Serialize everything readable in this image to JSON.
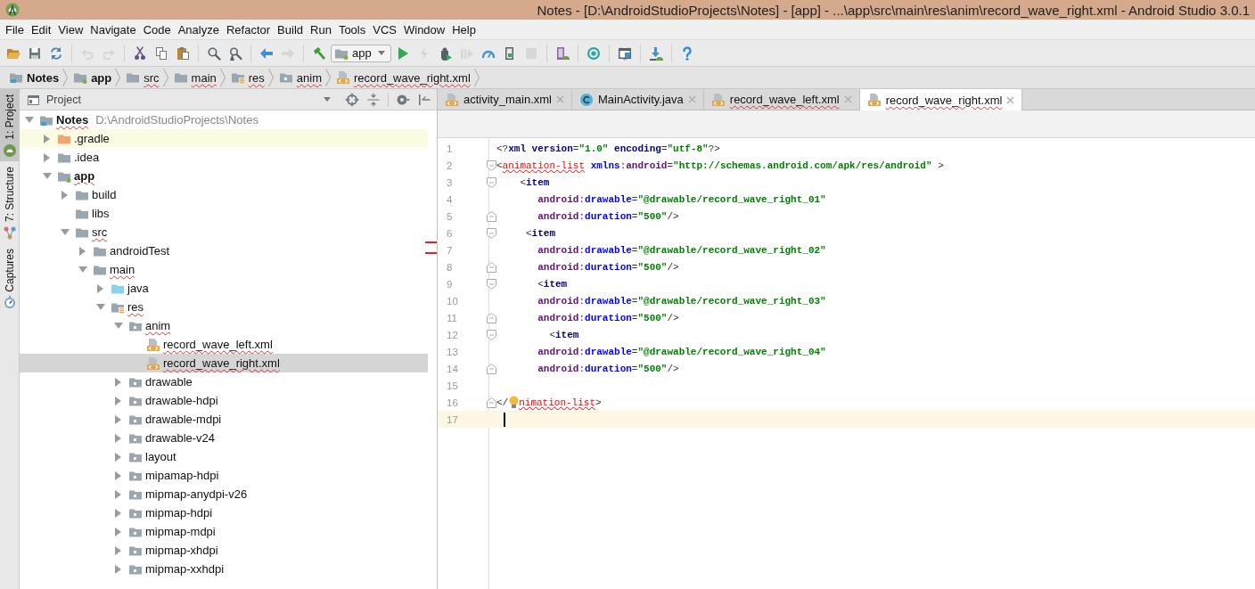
{
  "window": {
    "title": "Notes - [D:\\AndroidStudioProjects\\Notes] - [app] - ...\\app\\src\\main\\res\\anim\\record_wave_right.xml - Android Studio 3.0.1"
  },
  "menu": [
    "File",
    "Edit",
    "View",
    "Navigate",
    "Code",
    "Analyze",
    "Refactor",
    "Build",
    "Run",
    "Tools",
    "VCS",
    "Window",
    "Help"
  ],
  "toolbar": [
    {
      "kind": "open",
      "disabled": false
    },
    {
      "kind": "save",
      "disabled": false
    },
    {
      "kind": "sync",
      "disabled": false
    },
    {
      "kind": "separator"
    },
    {
      "kind": "undo",
      "disabled": true
    },
    {
      "kind": "redo",
      "disabled": true
    },
    {
      "kind": "separator"
    },
    {
      "kind": "cut",
      "disabled": false
    },
    {
      "kind": "copy",
      "disabled": false
    },
    {
      "kind": "paste",
      "disabled": false
    },
    {
      "kind": "separator"
    },
    {
      "kind": "find",
      "disabled": false
    },
    {
      "kind": "replace",
      "disabled": false
    },
    {
      "kind": "separator"
    },
    {
      "kind": "back",
      "disabled": false
    },
    {
      "kind": "forward",
      "disabled": true
    },
    {
      "kind": "separator"
    },
    {
      "kind": "make",
      "disabled": false
    },
    {
      "kind": "config",
      "label": "app"
    },
    {
      "kind": "run",
      "disabled": false
    },
    {
      "kind": "apply",
      "disabled": true
    },
    {
      "kind": "debug",
      "disabled": false
    },
    {
      "kind": "attach",
      "disabled": true
    },
    {
      "kind": "profiler",
      "disabled": false
    },
    {
      "kind": "device",
      "disabled": false
    },
    {
      "kind": "stop",
      "disabled": true
    },
    {
      "kind": "separator"
    },
    {
      "kind": "avd",
      "disabled": false
    },
    {
      "kind": "separator"
    },
    {
      "kind": "sdk",
      "disabled": false
    },
    {
      "kind": "separator"
    },
    {
      "kind": "structure",
      "disabled": false
    },
    {
      "kind": "separator"
    },
    {
      "kind": "sdkdownload",
      "disabled": false
    },
    {
      "kind": "separator"
    },
    {
      "kind": "help",
      "disabled": false
    }
  ],
  "breadcrumbs": [
    {
      "label": "Notes",
      "kind": "project",
      "spell_error": false
    },
    {
      "label": "app",
      "kind": "module",
      "spell_error": false
    },
    {
      "label": "src",
      "kind": "folder",
      "spell_error": true
    },
    {
      "label": "main",
      "kind": "folder",
      "spell_error": true
    },
    {
      "label": "res",
      "kind": "res",
      "spell_error": true
    },
    {
      "label": "anim",
      "kind": "res-folder",
      "spell_error": true
    },
    {
      "label": "record_wave_right.xml",
      "kind": "xml",
      "spell_error": true
    }
  ],
  "tool_windows": [
    {
      "label": "1: Project",
      "kind": "android",
      "selected": true
    },
    {
      "label": "7: Structure",
      "kind": "structure",
      "selected": false
    },
    {
      "label": "Captures",
      "kind": "captures",
      "selected": false
    }
  ],
  "project_panel": {
    "title": "Project",
    "tree": [
      {
        "name": "Notes",
        "path": "D:\\AndroidStudioProjects\\Notes",
        "kind": "project",
        "expanded": true,
        "selected": false,
        "highlighted": false,
        "spell_error": true,
        "children": [
          {
            "name": ".gradle",
            "kind": "folder-orange",
            "expanded": false,
            "selected": false,
            "highlighted": true,
            "spell_error": false
          },
          {
            "name": ".idea",
            "kind": "folder",
            "expanded": false,
            "selected": false,
            "highlighted": false,
            "spell_error": false
          },
          {
            "name": "app",
            "kind": "module",
            "expanded": true,
            "selected": false,
            "highlighted": false,
            "spell_error": true,
            "children": [
              {
                "name": "build",
                "kind": "folder",
                "expanded": false,
                "selected": false,
                "highlighted": false,
                "spell_error": false
              },
              {
                "name": "libs",
                "kind": "folder",
                "selected": false,
                "highlighted": false,
                "spell_error": false
              },
              {
                "name": "src",
                "kind": "folder",
                "expanded": true,
                "selected": false,
                "highlighted": false,
                "spell_error": true,
                "children": [
                  {
                    "name": "androidTest",
                    "kind": "folder",
                    "expanded": false,
                    "selected": false,
                    "highlighted": false,
                    "spell_error": false
                  },
                  {
                    "name": "main",
                    "kind": "folder",
                    "expanded": true,
                    "selected": false,
                    "highlighted": false,
                    "spell_error": true,
                    "children": [
                      {
                        "name": "java",
                        "kind": "folder-blue",
                        "expanded": false,
                        "selected": false,
                        "highlighted": false,
                        "spell_error": false
                      },
                      {
                        "name": "res",
                        "kind": "res",
                        "expanded": true,
                        "selected": false,
                        "highlighted": false,
                        "spell_error": true,
                        "children": [
                          {
                            "name": "anim",
                            "kind": "res-folder",
                            "expanded": true,
                            "selected": false,
                            "highlighted": false,
                            "spell_error": true,
                            "children": [
                              {
                                "name": "record_wave_left.xml",
                                "kind": "xml",
                                "selected": false,
                                "highlighted": false,
                                "spell_error": true
                              },
                              {
                                "name": "record_wave_right.xml",
                                "kind": "xml",
                                "selected": true,
                                "highlighted": false,
                                "spell_error": true
                              }
                            ]
                          },
                          {
                            "name": "drawable",
                            "kind": "res-folder",
                            "expanded": false,
                            "selected": false,
                            "highlighted": false,
                            "spell_error": false
                          },
                          {
                            "name": "drawable-hdpi",
                            "kind": "res-folder",
                            "expanded": false,
                            "selected": false,
                            "highlighted": false,
                            "spell_error": false
                          },
                          {
                            "name": "drawable-mdpi",
                            "kind": "res-folder",
                            "expanded": false,
                            "selected": false,
                            "highlighted": false,
                            "spell_error": false
                          },
                          {
                            "name": "drawable-v24",
                            "kind": "res-folder",
                            "expanded": false,
                            "selected": false,
                            "highlighted": false,
                            "spell_error": false
                          },
                          {
                            "name": "layout",
                            "kind": "res-folder",
                            "expanded": false,
                            "selected": false,
                            "highlighted": false,
                            "spell_error": false
                          },
                          {
                            "name": "mipamap-hdpi",
                            "kind": "res-folder",
                            "expanded": false,
                            "selected": false,
                            "highlighted": false,
                            "spell_error": false
                          },
                          {
                            "name": "mipmap-anydpi-v26",
                            "kind": "res-folder",
                            "expanded": false,
                            "selected": false,
                            "highlighted": false,
                            "spell_error": false
                          },
                          {
                            "name": "mipmap-hdpi",
                            "kind": "res-folder",
                            "expanded": false,
                            "selected": false,
                            "highlighted": false,
                            "spell_error": false
                          },
                          {
                            "name": "mipmap-mdpi",
                            "kind": "res-folder",
                            "expanded": false,
                            "selected": false,
                            "highlighted": false,
                            "spell_error": false
                          },
                          {
                            "name": "mipmap-xhdpi",
                            "kind": "res-folder",
                            "expanded": false,
                            "selected": false,
                            "highlighted": false,
                            "spell_error": false
                          },
                          {
                            "name": "mipmap-xxhdpi",
                            "kind": "res-folder",
                            "expanded": false,
                            "selected": false,
                            "highlighted": false,
                            "spell_error": false
                          }
                        ]
                      }
                    ]
                  }
                ]
              }
            ]
          }
        ]
      }
    ]
  },
  "editor": {
    "tabs": [
      {
        "label": "activity_main.xml",
        "kind": "xml",
        "selected": false,
        "spell_error": false
      },
      {
        "label": "MainActivity.java",
        "kind": "class",
        "selected": false,
        "spell_error": false
      },
      {
        "label": "record_wave_left.xml",
        "kind": "xml",
        "selected": false,
        "spell_error": true
      },
      {
        "label": "record_wave_right.xml",
        "kind": "xml",
        "selected": true,
        "spell_error": true
      }
    ],
    "lines": [
      {
        "number": "1",
        "kind": "plain",
        "current": false,
        "tokens": [
          {
            "kind": "punct",
            "text": "<?"
          },
          {
            "kind": "keyword",
            "text": "xml version"
          },
          {
            "kind": "punct",
            "text": "="
          },
          {
            "kind": "string",
            "text": "\"1.0\""
          },
          {
            "kind": "keyword",
            "text": " encoding"
          },
          {
            "kind": "punct",
            "text": "="
          },
          {
            "kind": "string",
            "text": "\"utf-8\""
          },
          {
            "kind": "punct",
            "text": "?>"
          }
        ]
      },
      {
        "number": "2",
        "kind": "fold-start",
        "current": false,
        "tokens": [
          {
            "kind": "punct",
            "text": "<"
          },
          {
            "kind": "error-tag",
            "text": "animation-list"
          },
          {
            "kind": "attribute",
            "text": " xmlns"
          },
          {
            "kind": "punct",
            "text": ":"
          },
          {
            "kind": "namespace",
            "text": "android"
          },
          {
            "kind": "punct",
            "text": "="
          },
          {
            "kind": "string",
            "text": "\"http://schemas.android.com/apk/res/android\""
          },
          {
            "kind": "punct",
            "text": " >"
          }
        ]
      },
      {
        "number": "3",
        "kind": "fold-start",
        "current": false,
        "tokens": [
          {
            "kind": "punct",
            "text": "    <"
          },
          {
            "kind": "keyword",
            "text": "item"
          }
        ]
      },
      {
        "number": "4",
        "kind": "plain",
        "current": false,
        "tokens": [
          {
            "kind": "namespace",
            "text": "       android"
          },
          {
            "kind": "punct",
            "text": ":"
          },
          {
            "kind": "attribute",
            "text": "drawable"
          },
          {
            "kind": "punct",
            "text": "="
          },
          {
            "kind": "string",
            "text": "\"@drawable/record_wave_right_01\""
          }
        ]
      },
      {
        "number": "5",
        "kind": "fold-end",
        "current": false,
        "tokens": [
          {
            "kind": "namespace",
            "text": "       android"
          },
          {
            "kind": "punct",
            "text": ":"
          },
          {
            "kind": "attribute",
            "text": "duration"
          },
          {
            "kind": "punct",
            "text": "="
          },
          {
            "kind": "string",
            "text": "\"500\""
          },
          {
            "kind": "punct",
            "text": "/>"
          }
        ]
      },
      {
        "number": "6",
        "kind": "fold-start",
        "current": false,
        "tokens": [
          {
            "kind": "punct",
            "text": "     <"
          },
          {
            "kind": "keyword",
            "text": "item"
          }
        ]
      },
      {
        "number": "7",
        "kind": "plain",
        "current": false,
        "tokens": [
          {
            "kind": "namespace",
            "text": "       android"
          },
          {
            "kind": "punct",
            "text": ":"
          },
          {
            "kind": "attribute",
            "text": "drawable"
          },
          {
            "kind": "punct",
            "text": "="
          },
          {
            "kind": "string",
            "text": "\"@drawable/record_wave_right_02\""
          }
        ]
      },
      {
        "number": "8",
        "kind": "fold-end",
        "current": false,
        "tokens": [
          {
            "kind": "namespace",
            "text": "       android"
          },
          {
            "kind": "punct",
            "text": ":"
          },
          {
            "kind": "attribute",
            "text": "duration"
          },
          {
            "kind": "punct",
            "text": "="
          },
          {
            "kind": "string",
            "text": "\"500\""
          },
          {
            "kind": "punct",
            "text": "/>"
          }
        ]
      },
      {
        "number": "9",
        "kind": "fold-start",
        "current": false,
        "tokens": [
          {
            "kind": "punct",
            "text": "       <"
          },
          {
            "kind": "keyword",
            "text": "item"
          }
        ]
      },
      {
        "number": "10",
        "kind": "plain",
        "current": false,
        "tokens": [
          {
            "kind": "namespace",
            "text": "       android"
          },
          {
            "kind": "punct",
            "text": ":"
          },
          {
            "kind": "attribute",
            "text": "drawable"
          },
          {
            "kind": "punct",
            "text": "="
          },
          {
            "kind": "string",
            "text": "\"@drawable/record_wave_right_03\""
          }
        ]
      },
      {
        "number": "11",
        "kind": "fold-end",
        "current": false,
        "tokens": [
          {
            "kind": "namespace",
            "text": "       android"
          },
          {
            "kind": "punct",
            "text": ":"
          },
          {
            "kind": "attribute",
            "text": "duration"
          },
          {
            "kind": "punct",
            "text": "="
          },
          {
            "kind": "string",
            "text": "\"500\""
          },
          {
            "kind": "punct",
            "text": "/>"
          }
        ]
      },
      {
        "number": "12",
        "kind": "fold-start",
        "current": false,
        "tokens": [
          {
            "kind": "punct",
            "text": "         <"
          },
          {
            "kind": "keyword",
            "text": "item"
          }
        ]
      },
      {
        "number": "13",
        "kind": "plain",
        "current": false,
        "tokens": [
          {
            "kind": "namespace",
            "text": "       android"
          },
          {
            "kind": "punct",
            "text": ":"
          },
          {
            "kind": "attribute",
            "text": "drawable"
          },
          {
            "kind": "punct",
            "text": "="
          },
          {
            "kind": "string",
            "text": "\"@drawable/record_wave_right_04\""
          }
        ]
      },
      {
        "number": "14",
        "kind": "fold-end",
        "current": false,
        "tokens": [
          {
            "kind": "namespace",
            "text": "       android"
          },
          {
            "kind": "punct",
            "text": ":"
          },
          {
            "kind": "attribute",
            "text": "duration"
          },
          {
            "kind": "punct",
            "text": "="
          },
          {
            "kind": "string",
            "text": "\"500\""
          },
          {
            "kind": "punct",
            "text": "/>"
          }
        ]
      },
      {
        "number": "15",
        "kind": "plain",
        "current": false
      },
      {
        "number": "16",
        "kind": "fold-end",
        "current": false,
        "tokens": [
          {
            "kind": "punct",
            "text": "</"
          },
          {
            "kind": "bulb"
          },
          {
            "kind": "error-tag",
            "text": "nimation-list"
          },
          {
            "kind": "punct",
            "text": ">"
          }
        ]
      },
      {
        "number": "17",
        "kind": "plain",
        "current": true
      }
    ]
  }
}
